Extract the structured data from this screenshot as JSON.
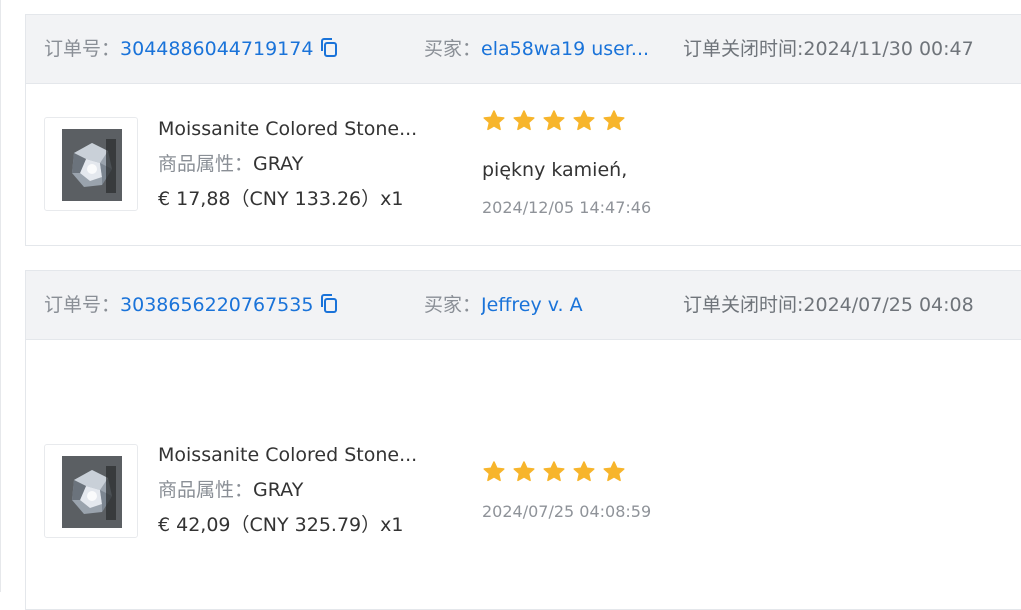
{
  "orders": [
    {
      "order_label": "订单号：",
      "order_number": "3044886044719174",
      "buyer_label": "买家：",
      "buyer_name": "ela58wa19 user...",
      "close_label": "订单关闭时间:",
      "close_time": "2024/11/30 00:47",
      "product_name": "Moissanite Colored Stone...",
      "attr_label": "商品属性：",
      "attr_value": "GRAY",
      "price": "€ 17,88（CNY  133.26）x1",
      "rating": 5,
      "review_text": "piękny kamień,",
      "review_date": "2024/12/05 14:47:46"
    },
    {
      "order_label": "订单号：",
      "order_number": "3038656220767535",
      "buyer_label": "买家：",
      "buyer_name": "Jeffrey v. A",
      "close_label": "订单关闭时间:",
      "close_time": "2024/07/25 04:08",
      "product_name": "Moissanite Colored Stone...",
      "attr_label": "商品属性：",
      "attr_value": "GRAY",
      "price": "€ 42,09（CNY  325.79）x1",
      "rating": 5,
      "review_text": "",
      "review_date": "2024/07/25 04:08:59"
    }
  ],
  "colors": {
    "link": "#1a73d9",
    "star": "#f7b52c",
    "header_bg": "#f2f3f5",
    "border": "#e4e7eb"
  },
  "icons": {
    "copy": "copy-icon",
    "star": "star-icon",
    "thumbnail": "gemstone-product-image"
  }
}
